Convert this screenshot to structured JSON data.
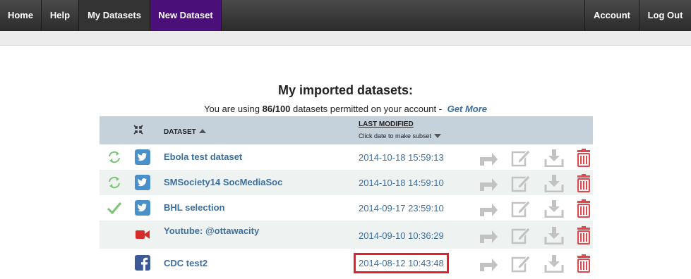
{
  "nav": {
    "home": "Home",
    "help": "Help",
    "my_datasets": "My Datasets",
    "new_dataset": "New Dataset",
    "account": "Account",
    "logout": "Log Out"
  },
  "page": {
    "title": "My imported datasets:",
    "usage_prefix": "You are using",
    "usage_count": "86/100",
    "usage_suffix": "datasets permitted on your account -",
    "get_more": "Get More"
  },
  "table": {
    "col_dataset": "DATASET",
    "col_modified": "LAST MODIFIED",
    "col_modified_hint": "Click date to make subset",
    "rows": [
      {
        "status": "sync-icon",
        "source": "twitter-icon",
        "name": "Ebola test dataset",
        "modified": "2014-10-18 15:59:13"
      },
      {
        "status": "sync-icon",
        "source": "twitter-icon",
        "name": "SMSociety14 SocMediaSoc",
        "modified": "2014-10-18 14:59:10"
      },
      {
        "status": "check-icon",
        "source": "twitter-icon",
        "name": "BHL selection",
        "modified": "2014-09-17 23:59:10"
      },
      {
        "status": "",
        "source": "youtube-icon",
        "name": "Youtube: @ottawacity",
        "modified": "2014-09-10 10:36:29"
      },
      {
        "status": "",
        "source": "facebook-icon",
        "name": "CDC test2",
        "modified": "2014-08-12 10:43:48",
        "highlighted": true
      }
    ]
  },
  "colors": {
    "link": "#3d6f9e",
    "header_bg": "#c5d2dc",
    "highlight": "#e0202a",
    "new_dataset_bg": "#4b0f7a"
  }
}
